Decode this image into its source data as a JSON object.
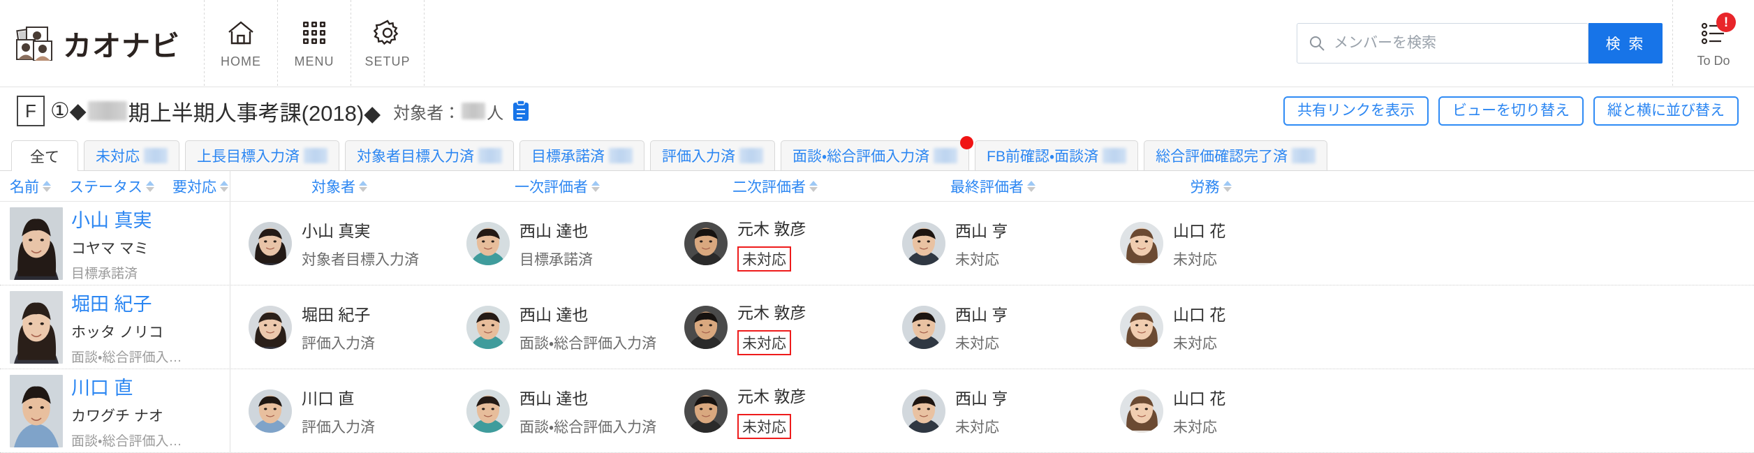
{
  "header": {
    "brand": "カオナビ",
    "brand_icon": "photos-stack-icon",
    "nav": [
      {
        "label": "HOME",
        "icon": "home-icon"
      },
      {
        "label": "MENU",
        "icon": "grid-menu-icon"
      },
      {
        "label": "SETUP",
        "icon": "gear-icon"
      }
    ],
    "search": {
      "placeholder": "メンバーを検索",
      "value": "",
      "button_label": "検 索",
      "icon": "search-icon"
    },
    "todo": {
      "label": "To Do",
      "icon": "todo-list-icon",
      "badge": "!"
    }
  },
  "title_bar": {
    "badge": "F",
    "prefix": "①◆",
    "masked_term": "",
    "title": "期上半期人事考課(2018)◆",
    "target_label": "対象者：",
    "target_count_masked": "",
    "target_unit": "人",
    "clipboard_icon": "clipboard-icon",
    "actions": [
      {
        "label": "共有リンクを表示",
        "name": "show-share-link-button"
      },
      {
        "label": "ビューを切り替え",
        "name": "switch-view-button"
      },
      {
        "label": "縦と横に並び替え",
        "name": "swap-rows-columns-button"
      }
    ]
  },
  "tabs": [
    {
      "label": "全て",
      "active": true,
      "count_masked": false,
      "dot": false
    },
    {
      "label": "未対応",
      "active": false,
      "count_masked": true,
      "dot": false
    },
    {
      "label": "上長目標入力済",
      "active": false,
      "count_masked": true,
      "dot": false
    },
    {
      "label": "対象者目標入力済",
      "active": false,
      "count_masked": true,
      "dot": false
    },
    {
      "label": "目標承諾済",
      "active": false,
      "count_masked": true,
      "dot": false
    },
    {
      "label": "評価入力済",
      "active": false,
      "count_masked": true,
      "dot": false
    },
    {
      "label": "面談・総合評価入力済",
      "active": false,
      "count_masked": true,
      "dot": true
    },
    {
      "label": "FB前確認・面談済",
      "active": false,
      "count_masked": true,
      "dot": false
    },
    {
      "label": "総合評価確認完了済",
      "active": false,
      "count_masked": true,
      "dot": false
    }
  ],
  "columns": {
    "fixed": [
      {
        "label": "名前",
        "name": "col-name"
      },
      {
        "label": "ステータス",
        "name": "col-status"
      },
      {
        "label": "要対応",
        "name": "col-action-required"
      }
    ],
    "evaluators": [
      {
        "label": "対象者",
        "name": "col-target-person"
      },
      {
        "label": "一次評価者",
        "name": "col-primary-evaluator"
      },
      {
        "label": "二次評価者",
        "name": "col-secondary-evaluator"
      },
      {
        "label": "最終評価者",
        "name": "col-final-evaluator"
      },
      {
        "label": "労務",
        "name": "col-labor"
      }
    ]
  },
  "rows": [
    {
      "name": "小山 真実",
      "kana": "コヤマ マミ",
      "status": "目標承諾済",
      "photo": "female-suit-1",
      "cells": [
        {
          "name": "小山 真実",
          "status": "対象者目標入力済",
          "alert": false,
          "photo": "female-suit-1"
        },
        {
          "name": "西山 達也",
          "status": "目標承諾済",
          "alert": false,
          "photo": "male-teal-1"
        },
        {
          "name": "元木 敦彦",
          "status": "未対応",
          "alert": true,
          "photo": "male-dark-1"
        },
        {
          "name": "西山 亨",
          "status": "未対応",
          "alert": false,
          "photo": "male-suit-2"
        },
        {
          "name": "山口 花",
          "status": "未対応",
          "alert": false,
          "photo": "female-brown-1"
        }
      ]
    },
    {
      "name": "堀田 紀子",
      "kana": "ホッタ ノリコ",
      "status": "面談・総合評価入…",
      "photo": "female-suit-2",
      "cells": [
        {
          "name": "堀田 紀子",
          "status": "評価入力済",
          "alert": false,
          "photo": "female-suit-2"
        },
        {
          "name": "西山 達也",
          "status": "面談・総合評価入力済",
          "alert": false,
          "photo": "male-teal-1"
        },
        {
          "name": "元木 敦彦",
          "status": "未対応",
          "alert": true,
          "photo": "male-dark-1"
        },
        {
          "name": "西山 亨",
          "status": "未対応",
          "alert": false,
          "photo": "male-suit-2"
        },
        {
          "name": "山口 花",
          "status": "未対応",
          "alert": false,
          "photo": "female-brown-1"
        }
      ]
    },
    {
      "name": "川口 直",
      "kana": "カワグチ ナオ",
      "status": "面談・総合評価入…",
      "photo": "male-shirt-1",
      "cells": [
        {
          "name": "川口 直",
          "status": "評価入力済",
          "alert": false,
          "photo": "male-shirt-1"
        },
        {
          "name": "西山 達也",
          "status": "面談・総合評価入力済",
          "alert": false,
          "photo": "male-teal-1"
        },
        {
          "name": "元木 敦彦",
          "status": "未対応",
          "alert": true,
          "photo": "male-dark-1"
        },
        {
          "name": "西山 亨",
          "status": "未対応",
          "alert": false,
          "photo": "male-suit-2"
        },
        {
          "name": "山口 花",
          "status": "未対応",
          "alert": false,
          "photo": "female-brown-1"
        }
      ]
    }
  ],
  "colors": {
    "accent_blue": "#2b86f2",
    "search_button": "#1774e8",
    "alert_red": "#ee1c1c",
    "badge_red": "#e8252a",
    "text_dark": "#2d2d2d"
  }
}
